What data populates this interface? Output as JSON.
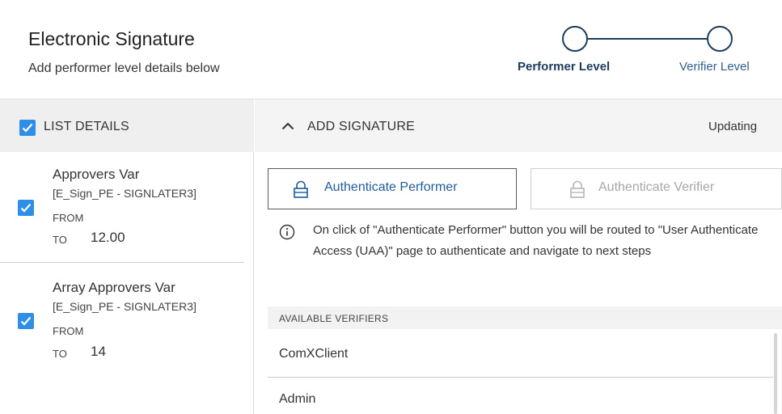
{
  "header": {
    "title": "Electronic Signature",
    "subtitle": "Add performer level details below"
  },
  "stepper": {
    "steps": [
      {
        "label": "Performer Level",
        "active": true
      },
      {
        "label": "Verifier Level",
        "active": false
      }
    ],
    "color": "#1d3c5c"
  },
  "left_panel": {
    "header_label": "LIST DETAILS",
    "header_checked": true,
    "items": [
      {
        "name": "Approvers Var",
        "code": "[E_Sign_PE - SIGNLATER3]",
        "from_label": "FROM",
        "to_label": "TO",
        "to_value": "12.00",
        "checked": true
      },
      {
        "name": "Array Approvers Var",
        "code": "[E_Sign_PE - SIGNLATER3]",
        "from_label": "FROM",
        "to_label": "TO",
        "to_value": "14",
        "checked": true
      }
    ]
  },
  "right_panel": {
    "header_label": "ADD SIGNATURE",
    "status_text": "Updating",
    "buttons": {
      "performer": "Authenticate Performer",
      "verifier": "Authenticate Verifier"
    },
    "info_text": "On click of \"Authenticate Performer\" button you will be routed to \"User Authenticate Access (UAA)\" page to authenticate and navigate to next steps",
    "verifiers_label": "AVAILABLE VERIFIERS",
    "verifiers": [
      "ComXClient",
      "Admin"
    ]
  },
  "colors": {
    "accent": "#2f8ee8",
    "primary_text": "#1f5c99",
    "disabled_text": "#a8a8a8"
  },
  "icons": [
    "checkbox-checked-icon",
    "chevron-up-icon",
    "lock-icon",
    "info-icon"
  ]
}
